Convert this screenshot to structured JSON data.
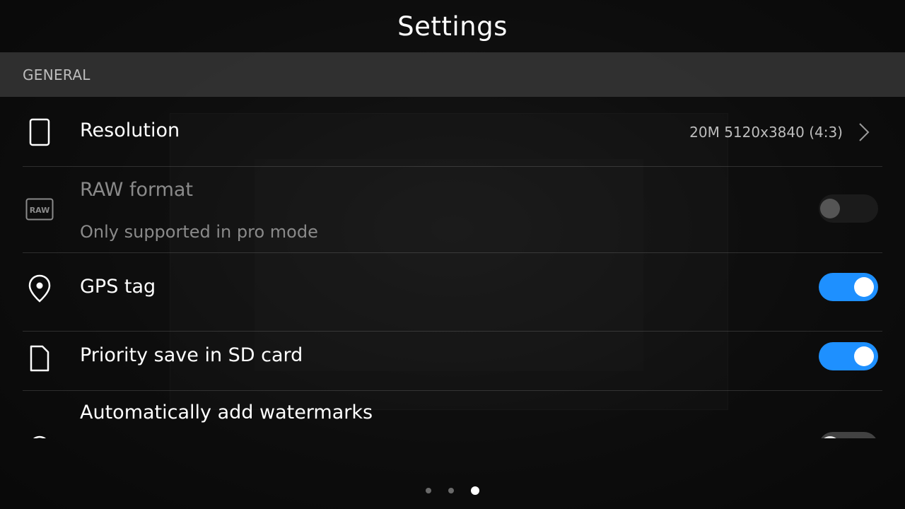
{
  "header": {
    "title": "Settings"
  },
  "section": {
    "label": "GENERAL"
  },
  "settings": {
    "resolution": {
      "label": "Resolution",
      "value": "20M 5120x3840 (4:3)",
      "icon": "phone-outline-icon"
    },
    "raw_format": {
      "label": "RAW format",
      "sublabel": "Only supported in pro mode",
      "icon_text": "RAW",
      "enabled": false,
      "toggle": "off"
    },
    "gps_tag": {
      "label": "GPS tag",
      "icon": "location-pin-icon",
      "toggle": "on"
    },
    "priority_save": {
      "label": "Priority save in SD card",
      "icon": "sd-card-icon",
      "toggle": "on"
    },
    "watermarks": {
      "label": "Automatically add watermarks",
      "icon": "watermark-icon",
      "toggle": "off"
    }
  },
  "pager": {
    "count": 3,
    "active_index": 2
  },
  "colors": {
    "accent": "#1e90ff",
    "background": "#0d0d0d",
    "section_bg": "#3a3a3a",
    "disabled_text": "#8a8a8a"
  }
}
